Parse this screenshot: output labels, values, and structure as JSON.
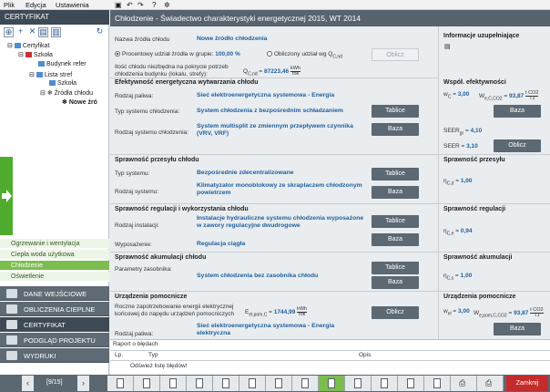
{
  "menu": {
    "file": "Plik",
    "edit": "Edycja",
    "settings": "Ustawienia"
  },
  "sidebar": {
    "header": "CERTYFIKAT",
    "tree": [
      {
        "label": "Certyfikat"
      },
      {
        "label": "Szkoła"
      },
      {
        "label": "Budynek refer"
      },
      {
        "label": "Lista stref"
      },
      {
        "label": "Szkoła"
      },
      {
        "label": "Źródła chłodu"
      },
      {
        "label": "Nowe źró"
      }
    ],
    "subnav": [
      "Ogrzewanie i wentylacja",
      "Ciepła woda użytkowa",
      "Chłodzenie",
      "Oświetlenie"
    ],
    "nav": [
      "DANE WEJŚCIOWE",
      "OBLICZENIA CIEPLNE",
      "CERTYFIKAT",
      "PODGLĄD PROJEKTU",
      "WYDRUKI"
    ]
  },
  "title": "Chłodzenie - Świadectwo charakterystyki energetycznej 2015, WT 2014",
  "source": {
    "name_label": "Nazwa źródła chłodu",
    "name_value": "Nowe źródło chłodzenia",
    "percent_label": "Procentowy udział źródła w grupie:",
    "percent_value": "100,00 %",
    "computed_label": "Obliczony udział wg Q",
    "computed_sub": "C,nd",
    "computed_btn": "Oblicz",
    "demand_label_1": "Ilość chłodu niezbędna na pokrycie potrzeb",
    "demand_label_2": "chłodzenia budynku (lokalu, strefy):",
    "demand_sym": "Q",
    "demand_sub": "C,nd",
    "demand_value": "87223,46",
    "demand_unit_num": "kWh",
    "demand_unit_den": "rok"
  },
  "info": {
    "title": "Informacje uzupełniające"
  },
  "generation": {
    "title": "Efektywność energetyczna wytwarzania chłodu",
    "fuel_label": "Rodzaj paliwa:",
    "fuel_value": "Sieć elektroenergetyczna systemowa - Energia",
    "system_type_label": "Typ systemu chłodzenia:",
    "system_type_value": "System chłodzenia z bezpośrednim schładzaniem",
    "system_type_btn": "Tablice",
    "system_kind_label": "Rodzaj systemu chłodzenia:",
    "system_kind_value": "System multisplit ze zmiennym przepływem czynnika (VRV, VRF)",
    "system_kind_btn": "Baza"
  },
  "coeffs": {
    "title": "Współ. efektywności",
    "wc_sym": "w",
    "wc_sub": "C",
    "wc_value": "3,00",
    "wco2_sym": "W",
    "wco2_sub": "e,C,CO2",
    "wco2_value": "93,87",
    "wco2_unit_num": "t CO2",
    "wco2_unit_den": "TJ",
    "baza_btn": "Baza",
    "seer_gr_label": "SEER",
    "seer_gr_sub": "gr",
    "seer_gr_value": "4,10",
    "seer_label": "SEER",
    "seer_value": "3,10",
    "oblicz_btn": "Oblicz"
  },
  "transfer": {
    "title": "Sprawność przesyłu chłodu",
    "type_label": "Typ systemu:",
    "type_value": "Bezpośrednie zdecentralizowane",
    "type_btn": "Tablice",
    "kind_label": "Rodzaj systemu:",
    "kind_value": "Klimatyzator monoblokowy ze skraplaczem chłodzonym powietrzem",
    "kind_btn": "Baza",
    "eff_title": "Sprawność przesyłu",
    "eff_sym": "η",
    "eff_sub": "C,d",
    "eff_value": "1,00"
  },
  "regulation": {
    "title": "Sprawność regulacji i wykorzystania chłodu",
    "inst_label": "Rodzaj instalacji:",
    "inst_value": "Instalacje hydrauliczne systemu chłodzenia wyposażone w zawory regulacyjne dwudrogowe",
    "inst_btn": "Tablice",
    "equip_label": "Wyposażenie:",
    "equip_value": "Regulacja ciągła",
    "equip_btn": "Baza",
    "eff_title": "Sprawność regulacji",
    "eff_sym": "η",
    "eff_sub": "C,e",
    "eff_value": "0,94"
  },
  "accumulation": {
    "title": "Sprawność akumulacji chłodu",
    "params_label": "Parametry zasobnika:",
    "params_value": "System chłodzenia bez zasobnika chłodu",
    "tablice_btn": "Tablice",
    "baza_btn": "Baza",
    "eff_title": "Sprawność akumulacji",
    "eff_sym": "η",
    "eff_sub": "C,s",
    "eff_value": "1,00"
  },
  "auxiliary": {
    "title": "Urządzenia pomocnicze",
    "demand_label_1": "Roczne zapotrzebowanie energii elektrycznej",
    "demand_label_2": "końcowej do napędu urządzeń pomocniczych",
    "demand_sym": "E",
    "demand_sub": "el,pom,C",
    "demand_value": "1744,99",
    "demand_unit_num": "kWh",
    "demand_unit_den": "rok",
    "oblicz_btn": "Oblicz",
    "fuel_label": "Rodzaj paliwa:",
    "fuel_value": "Sieć elektroenergetyczna systemowa - Energia elektryczna",
    "right_title": "Urządzenia pomocnicze",
    "wel_sym": "w",
    "wel_sub": "el",
    "wel_value": "3,00",
    "wco2_sym": "W",
    "wco2_sub": "e,pom,C,CO2",
    "wco2_value": "93,87",
    "wco2_unit_num": "t CO2",
    "wco2_unit_den": "TJ",
    "baza_btn": "Baza"
  },
  "errors": {
    "title": "Raport o błędach",
    "col_lp": "Lp.",
    "col_type": "Typ",
    "col_desc": "Opis",
    "refresh_row": "Odśwież listę błędów!"
  },
  "footer": {
    "page": "[9/15]",
    "close": "Zamknij"
  }
}
